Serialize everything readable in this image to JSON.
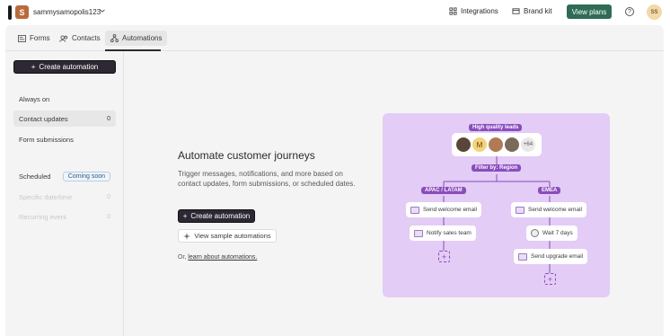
{
  "header": {
    "workspace_initial": "S",
    "workspace_name": "sammysamopolis123",
    "integrations_label": "Integrations",
    "brand_kit_label": "Brand kit",
    "view_plans_label": "View plans",
    "help_label": "?",
    "user_initials": "SS"
  },
  "tabs": [
    {
      "label": "Forms"
    },
    {
      "label": "Contacts"
    },
    {
      "label": "Automations"
    }
  ],
  "sidebar": {
    "create_label": "Create automation",
    "items": [
      {
        "label": "Always on",
        "count": ""
      },
      {
        "label": "Contact updates",
        "count": "0"
      },
      {
        "label": "Form submissions",
        "count": ""
      },
      {
        "label": "Scheduled",
        "badge": "Coming soon"
      },
      {
        "label": "Specific date/time",
        "count": "0"
      },
      {
        "label": "Recurring event",
        "count": "0"
      }
    ]
  },
  "main": {
    "headline": "Automate customer journeys",
    "description": "Trigger messages, notifications, and more based on contact updates, form submissions, or scheduled dates.",
    "create_label": "Create automation",
    "sample_label": "View sample automations",
    "learn_prefix": "Or,",
    "learn_link": "learn about automations."
  },
  "illustration": {
    "top_pill": "High quality leads",
    "avatar_letter": "M",
    "avatar_more": "+64",
    "filter_pill": "Filter by: Region",
    "left_branch": "APAC / LATAM",
    "right_branch": "EMEA",
    "left_steps": [
      "Send welcome email",
      "Notify sales team"
    ],
    "right_steps": [
      "Send welcome email",
      "Wait 7 days",
      "Send upgrade email"
    ],
    "colors": {
      "background": "#e3ccf5",
      "pill": "#8a4dbd"
    }
  }
}
